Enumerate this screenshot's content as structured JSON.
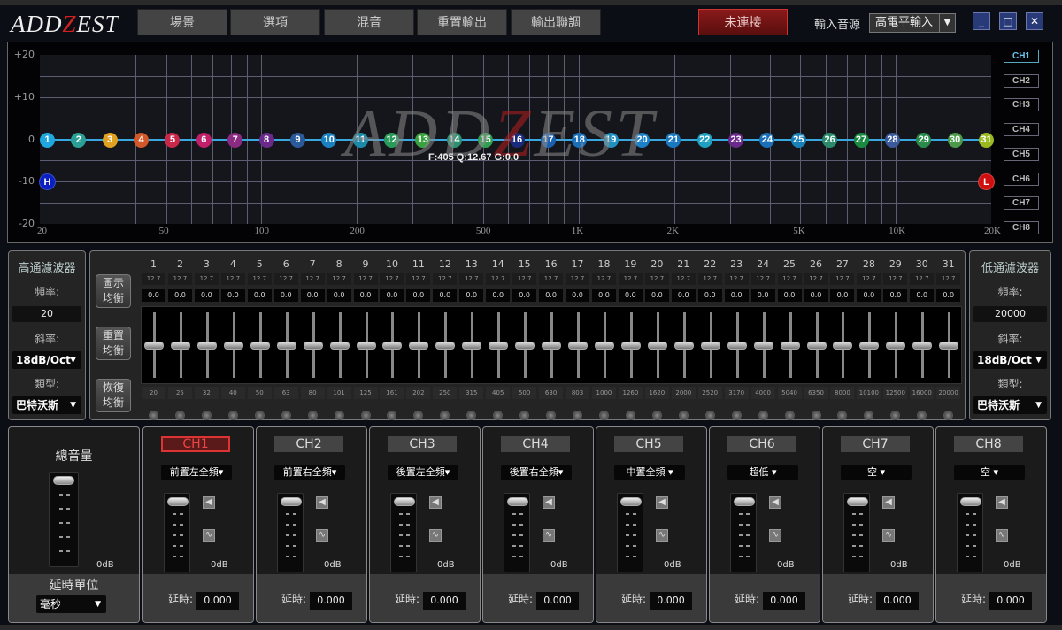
{
  "app": {
    "logo": "ADDZEST",
    "logo_left": "ADD",
    "logo_slash": "Z",
    "logo_right": "EST"
  },
  "menu": [
    {
      "label": "場景"
    },
    {
      "label": "選項"
    },
    {
      "label": "混音"
    },
    {
      "label": "重置輸出"
    },
    {
      "label": "輸出聯調"
    }
  ],
  "connection": {
    "label": "未連接",
    "color": "#8a1a1a"
  },
  "input_source": {
    "label": "輸入音源",
    "value": "高電平輸入"
  },
  "window_controls": {
    "minimize": "_",
    "maximize": "□",
    "close": "✕"
  },
  "graph": {
    "y_ticks": [
      "+20",
      "+10",
      "0",
      "-10",
      "-20"
    ],
    "x_ticks": [
      "20",
      "50",
      "100",
      "200",
      "500",
      "1K",
      "2K",
      "5K",
      "10K",
      "20K"
    ],
    "readout": "F:405 Q:12.67 G:0.0",
    "nodes": [
      {
        "n": "1",
        "c": "#1fa8e0"
      },
      {
        "n": "2",
        "c": "#2a9f95"
      },
      {
        "n": "3",
        "c": "#e0a020"
      },
      {
        "n": "4",
        "c": "#d2582a"
      },
      {
        "n": "5",
        "c": "#c8284a"
      },
      {
        "n": "6",
        "c": "#c0206a"
      },
      {
        "n": "7",
        "c": "#8a2a80"
      },
      {
        "n": "8",
        "c": "#6a2a8a"
      },
      {
        "n": "9",
        "c": "#2a5a9a"
      },
      {
        "n": "10",
        "c": "#1a80c0"
      },
      {
        "n": "11",
        "c": "#1a8aa8"
      },
      {
        "n": "12",
        "c": "#2a9a5a"
      },
      {
        "n": "13",
        "c": "#3aa040"
      },
      {
        "n": "14",
        "c": "#2a9070"
      },
      {
        "n": "15",
        "c": "#30a050"
      },
      {
        "n": "16",
        "c": "#1a2a7a"
      },
      {
        "n": "17",
        "c": "#1a60b0"
      },
      {
        "n": "18",
        "c": "#1a70b8"
      },
      {
        "n": "19",
        "c": "#2090c0"
      },
      {
        "n": "20",
        "c": "#1a80c8"
      },
      {
        "n": "21",
        "c": "#1a78c0"
      },
      {
        "n": "22",
        "c": "#20a0c0"
      },
      {
        "n": "23",
        "c": "#6a2a8a"
      },
      {
        "n": "24",
        "c": "#1a70b8"
      },
      {
        "n": "25",
        "c": "#1a80b8"
      },
      {
        "n": "26",
        "c": "#2a8a6a"
      },
      {
        "n": "27",
        "c": "#1a8a40"
      },
      {
        "n": "28",
        "c": "#3a5a9a"
      },
      {
        "n": "29",
        "c": "#2a8a4a"
      },
      {
        "n": "30",
        "c": "#4a9a4a"
      },
      {
        "n": "31",
        "c": "#9ab820"
      }
    ],
    "gain_db": 0,
    "hp_marker": {
      "label": "H",
      "gain_db": -10,
      "color": "#0a20c0"
    },
    "lp_marker": {
      "label": "L",
      "gain_db": -10,
      "color": "#d01010"
    },
    "channels": [
      "CH1",
      "CH2",
      "CH3",
      "CH4",
      "CH5",
      "CH6",
      "CH7",
      "CH8"
    ],
    "active_channel": "CH1"
  },
  "highpass": {
    "title": "高通濾波器",
    "freq_label": "頻率:",
    "freq": "20",
    "slope_label": "斜率:",
    "slope": "18dB/Oct",
    "type_label": "類型:",
    "type": "巴特沃斯"
  },
  "lowpass": {
    "title": "低通濾波器",
    "freq_label": "頻率:",
    "freq": "20000",
    "slope_label": "斜率:",
    "slope": "18dB/Oct",
    "type_label": "類型:",
    "type": "巴特沃斯"
  },
  "eq_buttons": [
    {
      "l1": "圖示",
      "l2": "均衡"
    },
    {
      "l1": "重置",
      "l2": "均衡"
    },
    {
      "l1": "恢復",
      "l2": "均衡"
    }
  ],
  "eq": {
    "q": "12.7",
    "gain": "0.0",
    "freqs": [
      "20",
      "25",
      "32",
      "40",
      "50",
      "63",
      "80",
      "101",
      "125",
      "161",
      "202",
      "250",
      "315",
      "405",
      "500",
      "630",
      "803",
      "1000",
      "1260",
      "1620",
      "2000",
      "2520",
      "3170",
      "4000",
      "5040",
      "6350",
      "8000",
      "10100",
      "12500",
      "16000",
      "20000"
    ]
  },
  "master": {
    "title": "總音量",
    "db": "0dB",
    "delay_unit_label": "延時單位",
    "delay_unit": "毫秒"
  },
  "strips": [
    {
      "ch": "CH1",
      "route": "前置左全頻▾",
      "db": "0dB",
      "delay_label": "延時:",
      "delay": "0.000"
    },
    {
      "ch": "CH2",
      "route": "前置右全頻▾",
      "db": "0dB",
      "delay_label": "延時:",
      "delay": "0.000"
    },
    {
      "ch": "CH3",
      "route": "後置左全頻▾",
      "db": "0dB",
      "delay_label": "延時:",
      "delay": "0.000"
    },
    {
      "ch": "CH4",
      "route": "後置右全頻▾",
      "db": "0dB",
      "delay_label": "延時:",
      "delay": "0.000"
    },
    {
      "ch": "CH5",
      "route": "中置全頻 ▾",
      "db": "0dB",
      "delay_label": "延時:",
      "delay": "0.000"
    },
    {
      "ch": "CH6",
      "route": "超低 ▾",
      "db": "0dB",
      "delay_label": "延時:",
      "delay": "0.000"
    },
    {
      "ch": "CH7",
      "route": "空 ▾",
      "db": "0dB",
      "delay_label": "延時:",
      "delay": "0.000"
    },
    {
      "ch": "CH8",
      "route": "空 ▾",
      "db": "0dB",
      "delay_label": "延時:",
      "delay": "0.000"
    }
  ]
}
